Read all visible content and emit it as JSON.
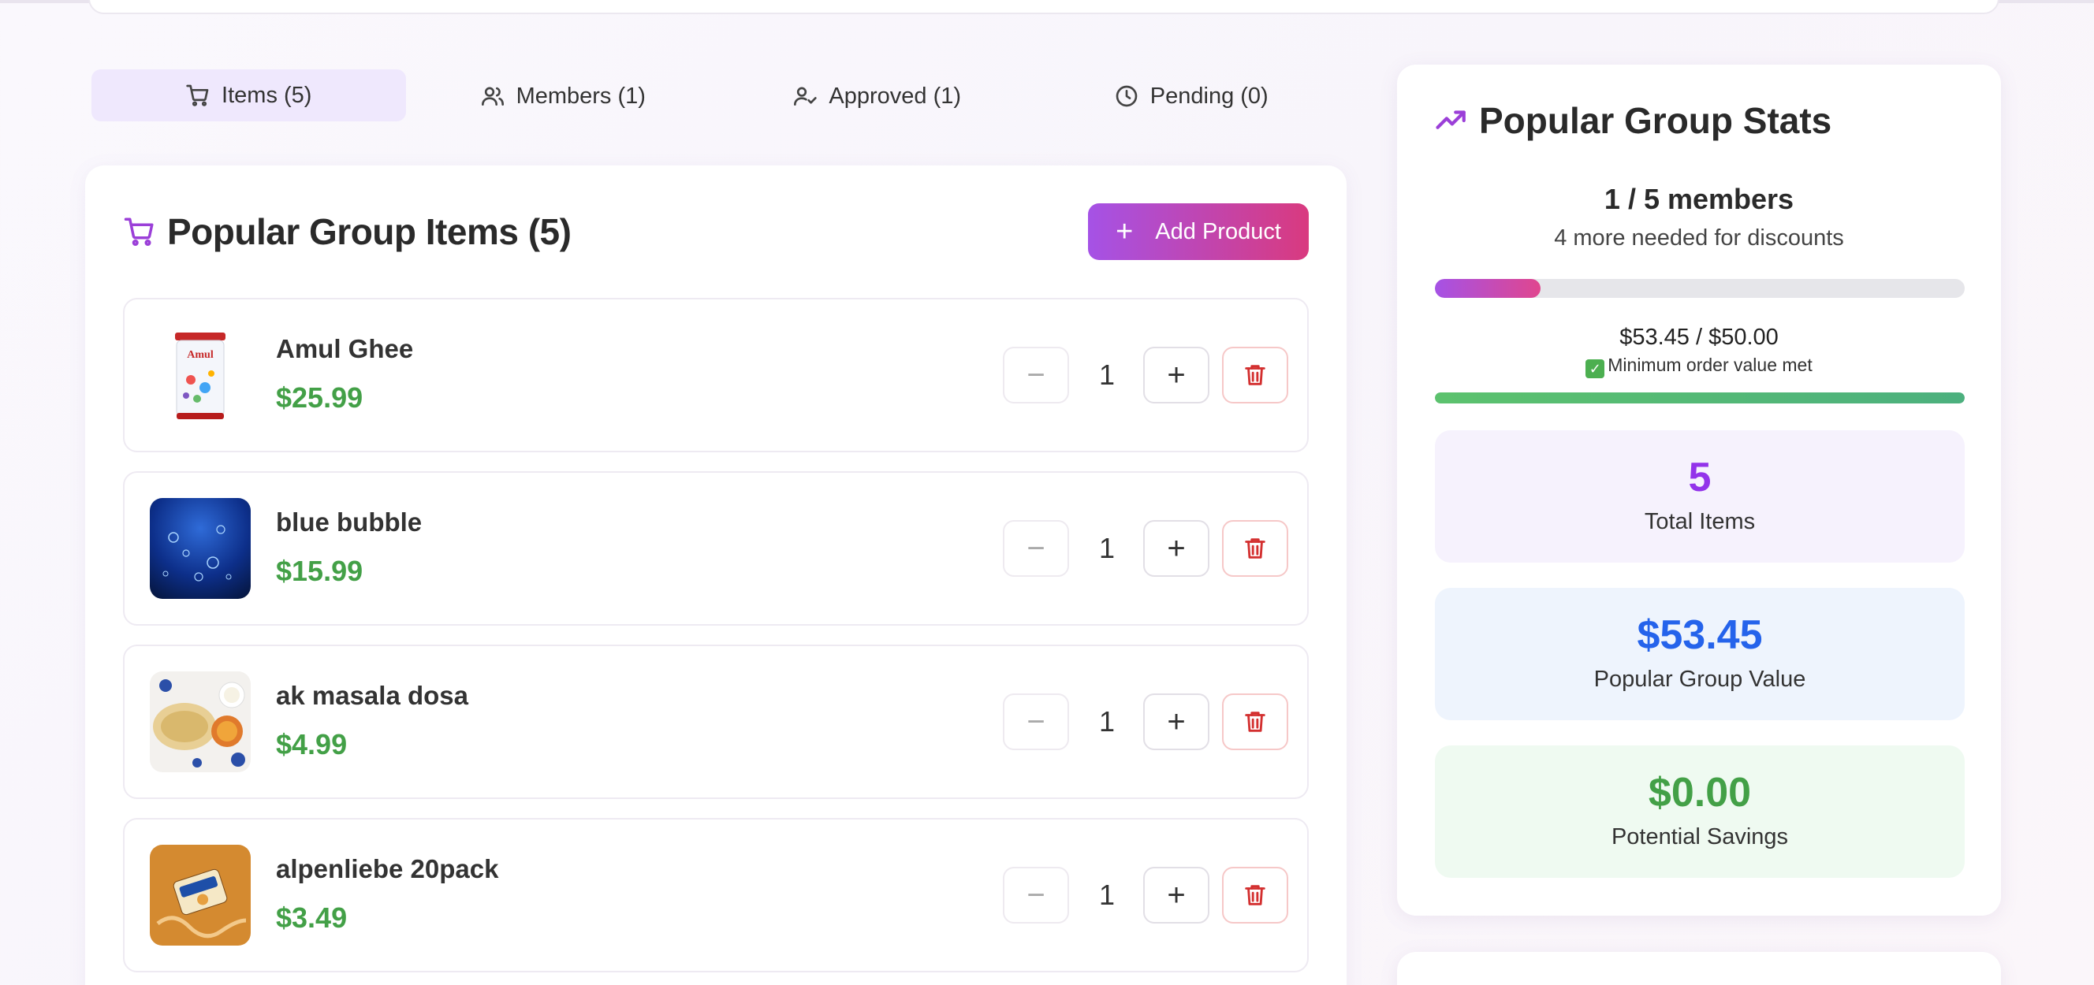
{
  "tabs": [
    {
      "label": "Items (5)",
      "icon": "cart-icon",
      "active": true
    },
    {
      "label": "Members (1)",
      "icon": "users-icon",
      "active": false
    },
    {
      "label": "Approved (1)",
      "icon": "user-check-icon",
      "active": false
    },
    {
      "label": "Pending (0)",
      "icon": "clock-icon",
      "active": false
    }
  ],
  "items_panel": {
    "title": "Popular Group Items (5)",
    "add_button": "Add Product"
  },
  "items": [
    {
      "name": "Amul Ghee",
      "price": "$25.99",
      "qty": "1"
    },
    {
      "name": "blue bubble",
      "price": "$15.99",
      "qty": "1"
    },
    {
      "name": "ak masala dosa",
      "price": "$4.99",
      "qty": "1"
    },
    {
      "name": "alpenliebe 20pack",
      "price": "$3.49",
      "qty": "1"
    }
  ],
  "stats": {
    "title": "Popular Group Stats",
    "members": "1 / 5 members",
    "members_note": "4 more needed for discounts",
    "members_progress": 0.2,
    "order_value": "$53.45 / $50.00",
    "order_note": "Minimum order value met",
    "order_progress": 1.0,
    "total_items_value": "5",
    "total_items_label": "Total Items",
    "group_value": "$53.45",
    "group_value_label": "Popular Group Value",
    "savings_value": "$0.00",
    "savings_label": "Potential Savings"
  },
  "colors": {
    "accent": "#9b3fd8",
    "price_green": "#43a047",
    "stat_purple": "#9333ea",
    "stat_blue": "#2563eb",
    "delete_red": "#d32f2f"
  }
}
